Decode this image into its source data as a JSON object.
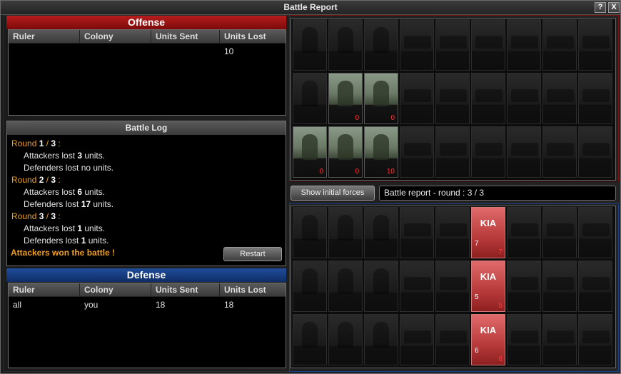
{
  "window": {
    "title": "Battle Report",
    "help_label": "?",
    "close_label": "X"
  },
  "offense": {
    "title": "Offense",
    "columns": [
      "Ruler",
      "Colony",
      "Units Sent",
      "Units Lost"
    ],
    "rows": [
      {
        "ruler": "",
        "colony": "",
        "units_sent": "",
        "units_lost": "10"
      }
    ]
  },
  "battle_log": {
    "title": "Battle Log",
    "rounds": [
      {
        "prefix": "Round ",
        "num": "1",
        "sep": " / ",
        "total": "3",
        "suffix": " :",
        "attackers_pre": "Attackers lost ",
        "attackers_val": "3",
        "attackers_post": " units.",
        "defenders_pre": "Defenders lost ",
        "defenders_val": "",
        "defenders_post": "no units."
      },
      {
        "prefix": "Round ",
        "num": "2",
        "sep": " / ",
        "total": "3",
        "suffix": " :",
        "attackers_pre": "Attackers lost ",
        "attackers_val": "6",
        "attackers_post": " units.",
        "defenders_pre": "Defenders lost ",
        "defenders_val": "17",
        "defenders_post": " units."
      },
      {
        "prefix": "Round ",
        "num": "3",
        "sep": " / ",
        "total": "3",
        "suffix": " :",
        "attackers_pre": "Attackers lost ",
        "attackers_val": "1",
        "attackers_post": " units.",
        "defenders_pre": "Defenders lost ",
        "defenders_val": "1",
        "defenders_post": " units."
      }
    ],
    "result": "Attackers won the battle !",
    "restart_label": "Restart"
  },
  "defense": {
    "title": "Defense",
    "columns": [
      "Ruler",
      "Colony",
      "Units Sent",
      "Units Lost"
    ],
    "rows": [
      {
        "ruler": "all",
        "colony": "you",
        "units_sent": "18",
        "units_lost": "18"
      }
    ]
  },
  "controls": {
    "show_initial_label": "Show initial forces",
    "status_text": "Battle report - round : 3 / 3"
  },
  "attacker_grid": {
    "rows": [
      [
        {
          "t": "inf"
        },
        {
          "t": "inf"
        },
        {
          "t": "inf"
        },
        {
          "t": "veh"
        },
        {
          "t": "veh"
        },
        {
          "t": "veh"
        },
        {
          "t": "veh"
        },
        {
          "t": "veh"
        },
        {
          "t": "veh"
        }
      ],
      [
        {
          "t": "inf"
        },
        {
          "t": "inf",
          "lit": true,
          "count": "0"
        },
        {
          "t": "inf",
          "lit": true,
          "count": "0"
        },
        {
          "t": "veh"
        },
        {
          "t": "veh"
        },
        {
          "t": "veh"
        },
        {
          "t": "veh"
        },
        {
          "t": "veh"
        },
        {
          "t": "veh"
        }
      ],
      [
        {
          "t": "inf",
          "lit": true,
          "count": "0"
        },
        {
          "t": "inf",
          "lit": true,
          "count": "0"
        },
        {
          "t": "inf",
          "lit": true,
          "count": "10"
        },
        {
          "t": "veh"
        },
        {
          "t": "veh"
        },
        {
          "t": "veh"
        },
        {
          "t": "veh"
        },
        {
          "t": "veh"
        },
        {
          "t": "veh"
        }
      ]
    ]
  },
  "defender_grid": {
    "rows": [
      [
        {
          "t": "inf"
        },
        {
          "t": "inf"
        },
        {
          "t": "inf"
        },
        {
          "t": "veh"
        },
        {
          "t": "veh"
        },
        {
          "t": "kia",
          "label": "KIA",
          "left": "7",
          "right": "7"
        },
        {
          "t": "veh"
        },
        {
          "t": "veh"
        },
        {
          "t": "veh"
        }
      ],
      [
        {
          "t": "inf"
        },
        {
          "t": "inf"
        },
        {
          "t": "inf"
        },
        {
          "t": "veh"
        },
        {
          "t": "veh"
        },
        {
          "t": "kia",
          "label": "KIA",
          "left": "5",
          "right": "5"
        },
        {
          "t": "veh"
        },
        {
          "t": "veh"
        },
        {
          "t": "veh"
        }
      ],
      [
        {
          "t": "inf"
        },
        {
          "t": "inf"
        },
        {
          "t": "inf"
        },
        {
          "t": "veh"
        },
        {
          "t": "veh"
        },
        {
          "t": "kia",
          "label": "KIA",
          "left": "6",
          "right": "6"
        },
        {
          "t": "veh"
        },
        {
          "t": "veh"
        },
        {
          "t": "veh"
        }
      ]
    ]
  },
  "colors": {
    "offense": "#a01414",
    "defense": "#183f86",
    "accent": "#f0a020",
    "loss": "#ff3030"
  }
}
